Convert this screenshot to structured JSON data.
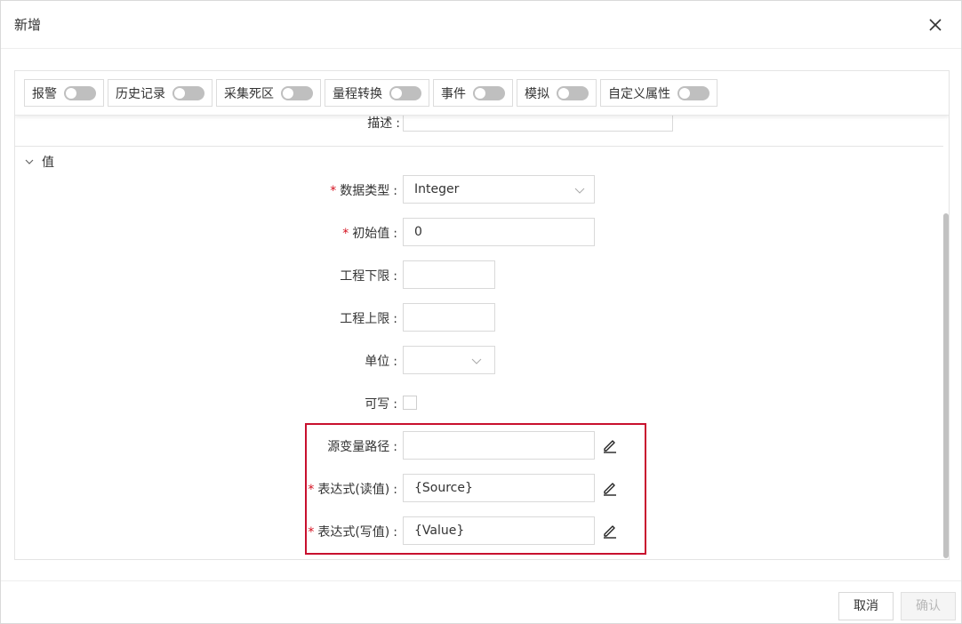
{
  "dialog": {
    "title": "新增"
  },
  "toggles": [
    {
      "label": "报警",
      "on": false
    },
    {
      "label": "历史记录",
      "on": false
    },
    {
      "label": "采集死区",
      "on": false
    },
    {
      "label": "量程转换",
      "on": false
    },
    {
      "label": "事件",
      "on": false
    },
    {
      "label": "模拟",
      "on": false
    },
    {
      "label": "自定义属性",
      "on": false
    }
  ],
  "description": {
    "label": "描述"
  },
  "section": {
    "title": "值"
  },
  "form": {
    "required_mark": "*",
    "colon": ":",
    "data_type": {
      "label": "数据类型",
      "value": "Integer"
    },
    "initial_value": {
      "label": "初始值",
      "value": "0"
    },
    "eng_low": {
      "label": "工程下限",
      "value": ""
    },
    "eng_high": {
      "label": "工程上限",
      "value": ""
    },
    "unit": {
      "label": "单位",
      "value": ""
    },
    "writable": {
      "label": "可写",
      "checked": false
    },
    "source_path": {
      "label": "源变量路径",
      "value": ""
    },
    "expr_read": {
      "label": "表达式(读值)",
      "value": "{Source}"
    },
    "expr_write": {
      "label": "表达式(写值)",
      "value": "{Value}"
    }
  },
  "footer": {
    "cancel_label": "取消",
    "ok_label": "确认"
  },
  "colors": {
    "required": "#d4101f",
    "highlight": "#c8102e",
    "switch_off": "#bfbfbf"
  }
}
